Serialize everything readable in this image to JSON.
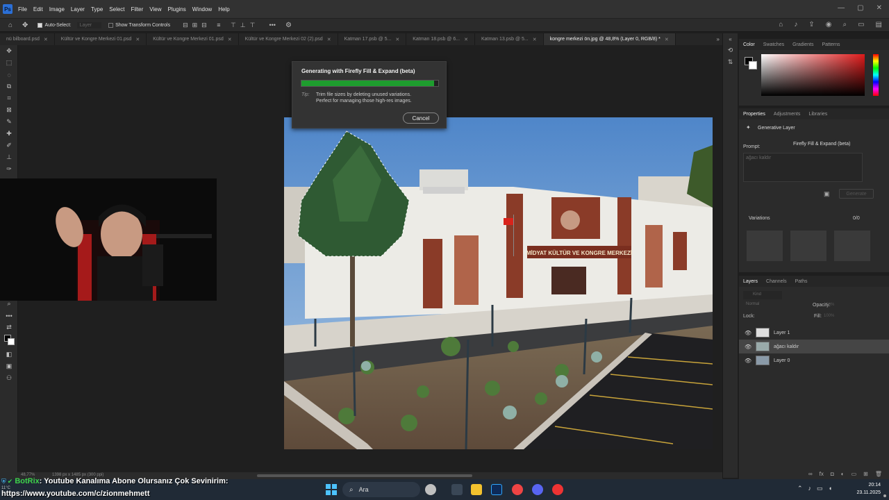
{
  "menu": {
    "items": [
      "File",
      "Edit",
      "Image",
      "Layer",
      "Type",
      "Select",
      "Filter",
      "View",
      "Plugins",
      "Window",
      "Help"
    ]
  },
  "options": {
    "auto_select_label": "Auto-Select:",
    "auto_select_value": "Layer",
    "show_transform_label": "Show Transform Controls"
  },
  "tabs": [
    {
      "label": "nü bilboard.psd",
      "active": false
    },
    {
      "label": "Kültür ve Kongre Merkezi 01.psd",
      "active": false
    },
    {
      "label": "Kültür ve Kongre Merkezi 01.psd",
      "active": false
    },
    {
      "label": "Kültür ve Kongre Merkezi 02 (2).psd",
      "active": false
    },
    {
      "label": "Katman 17.psb @ 5...",
      "active": false
    },
    {
      "label": "Katman 18.psb @ 6...",
      "active": false
    },
    {
      "label": "Katman 13.psb @ 5...",
      "active": false
    },
    {
      "label": "kongre merkezi ön.jpg @ 48,8% (Layer 0, RGB/8) *",
      "active": true
    }
  ],
  "dialog": {
    "title": "Generating with Firefly Fill & Expand (beta)",
    "progress": 0.97,
    "tip_label": "Tip:",
    "tip_text_1": "Trim file sizes by deleting unused variations.",
    "tip_text_2": "Perfect for managing those high-res images.",
    "cancel": "Cancel"
  },
  "photo": {
    "sign": "MİDYAT KÜLTÜR VE KONGRE MERKEZİ"
  },
  "color_panel": {
    "tabs": [
      "Color",
      "Swatches",
      "Gradients",
      "Patterns"
    ]
  },
  "properties": {
    "tabs": [
      "Properties",
      "Adjustments",
      "Libraries"
    ],
    "layer_type": "Generative Layer",
    "prompt_label": "Prompt:",
    "model": "Firefly Fill & Expand (beta)",
    "prompt_value": "ağacı kaldır",
    "generate": "Generate",
    "variations_label": "Variations",
    "variations_count": "0/0"
  },
  "layers_panel": {
    "tabs": [
      "Layers",
      "Channels",
      "Paths"
    ],
    "search_placeholder": "Kind",
    "blend_mode": "Normal",
    "opacity_label": "Opacity:",
    "opacity_value": "100%",
    "lock_label": "Lock:",
    "fill_label": "Fill:",
    "fill_value": "100%",
    "layers": [
      {
        "name": "Layer 1",
        "selected": false
      },
      {
        "name": "ağacı kaldır",
        "selected": true
      },
      {
        "name": "Layer 0",
        "selected": false
      }
    ]
  },
  "status": {
    "zoom": "48,77%",
    "doc": "1398 px x 1485 px (300 ppi)"
  },
  "chat_overlay": {
    "bot": "BotRix",
    "message": ": Youtube Kanalıma Abone Olursanız Çok Sevinirim:",
    "url": "https://www.youtube.com/c/zionmehmett"
  },
  "taskbar": {
    "search_label": "Ara",
    "time": "20:14",
    "date": "23.11.2025",
    "weather": "11°C"
  },
  "colors": {
    "progress": "#1e9d2e",
    "accent": "#2b6fd6"
  }
}
